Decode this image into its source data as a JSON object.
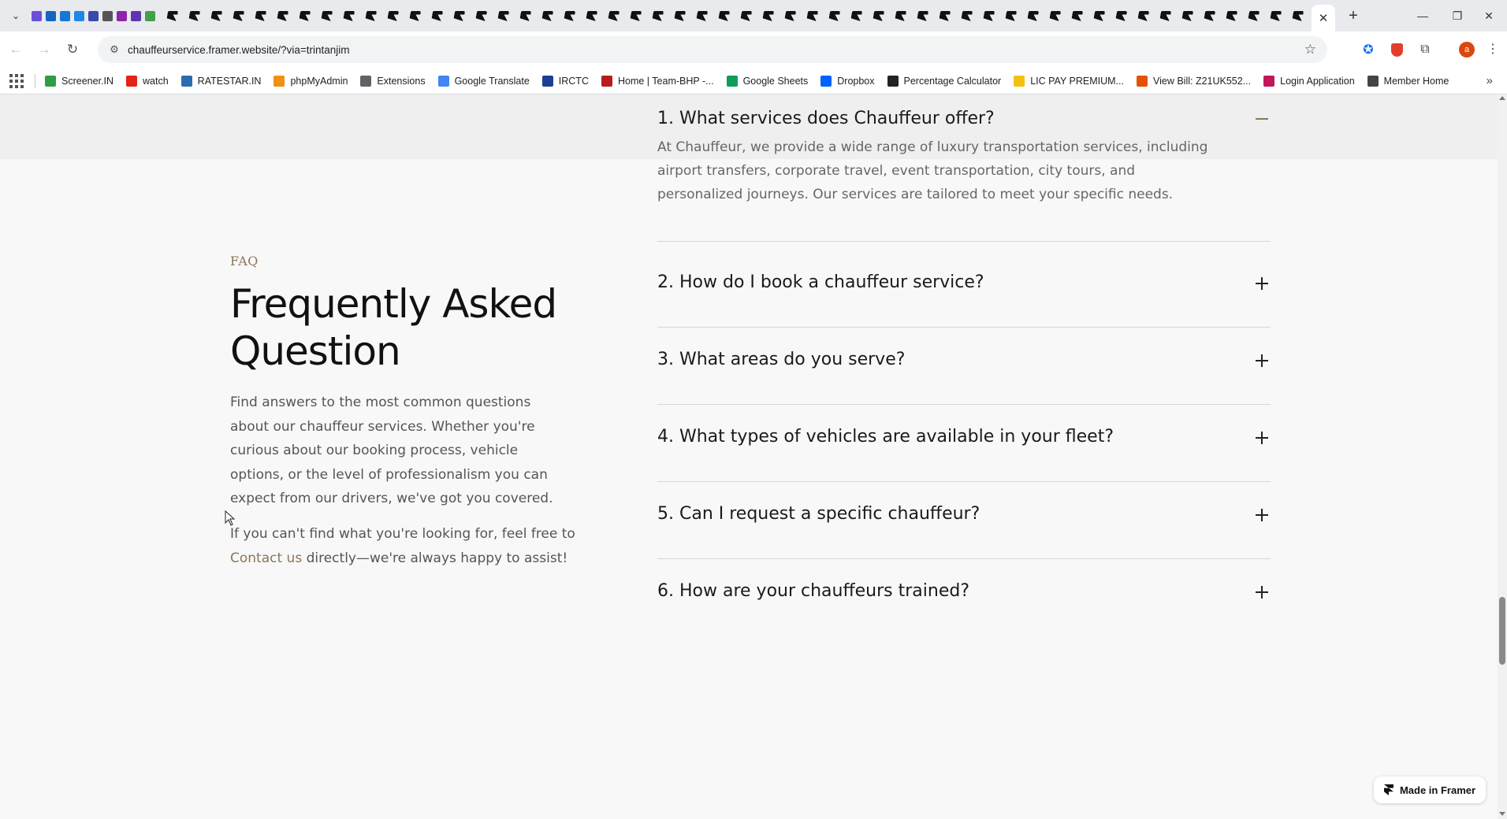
{
  "browser": {
    "url": "chauffeurservice.framer.website/?via=trintanjim",
    "profile_initial": "a",
    "bookmarks": [
      {
        "label": "Screener.IN",
        "color": "#2e9d43"
      },
      {
        "label": "watch",
        "color": "#e62117"
      },
      {
        "label": "RATESTAR.IN",
        "color": "#2b6cb0"
      },
      {
        "label": "phpMyAdmin",
        "color": "#f29111"
      },
      {
        "label": "Extensions",
        "color": "#5f6368"
      },
      {
        "label": "Google Translate",
        "color": "#4285f4"
      },
      {
        "label": "IRCTC",
        "color": "#1c3f94"
      },
      {
        "label": "Home | Team-BHP -...",
        "color": "#b71c1c"
      },
      {
        "label": "Google Sheets",
        "color": "#0f9d58"
      },
      {
        "label": "Dropbox",
        "color": "#0061fe"
      },
      {
        "label": "Percentage Calculator",
        "color": "#222222"
      },
      {
        "label": "LIC PAY PREMIUM...",
        "color": "#f4c20d"
      },
      {
        "label": "View Bill: Z21UK552...",
        "color": "#e65100"
      },
      {
        "label": "Login Application",
        "color": "#c2185b"
      },
      {
        "label": "Member Home",
        "color": "#444444"
      }
    ]
  },
  "faq": {
    "tag": "FAQ",
    "title": "Frequently Asked Question",
    "description": "Find answers to the most common questions about our chauffeur services. Whether you're curious about our booking process, vehicle options, or the level of professionalism you can expect from our drivers, we've got you covered.",
    "contact_prefix": "If you can't find what you're looking for, feel free to",
    "contact_link": "Contact us",
    "contact_suffix": "directly—we're always happy to assist!",
    "items": [
      {
        "question": "1. What services does Chauffeur offer?",
        "expanded": true,
        "answer": "At Chauffeur, we provide a wide range of luxury transportation services, including airport transfers, corporate travel, event transportation, city tours, and personalized journeys. Our services are tailored to meet your specific needs."
      },
      {
        "question": "2. How do I book a chauffeur service?",
        "expanded": false
      },
      {
        "question": "3. What areas do you serve?",
        "expanded": false
      },
      {
        "question": "4. What types of vehicles are available in your fleet?",
        "expanded": false
      },
      {
        "question": "5. Can I request a specific chauffeur?",
        "expanded": false
      },
      {
        "question": "6. How are your chauffeurs trained?",
        "expanded": false
      }
    ]
  },
  "badge": {
    "label": "Made in Framer"
  },
  "colors": {
    "accent": "#8c7559",
    "text": "#111111",
    "muted": "#555555",
    "background": "#f8f8f8"
  }
}
